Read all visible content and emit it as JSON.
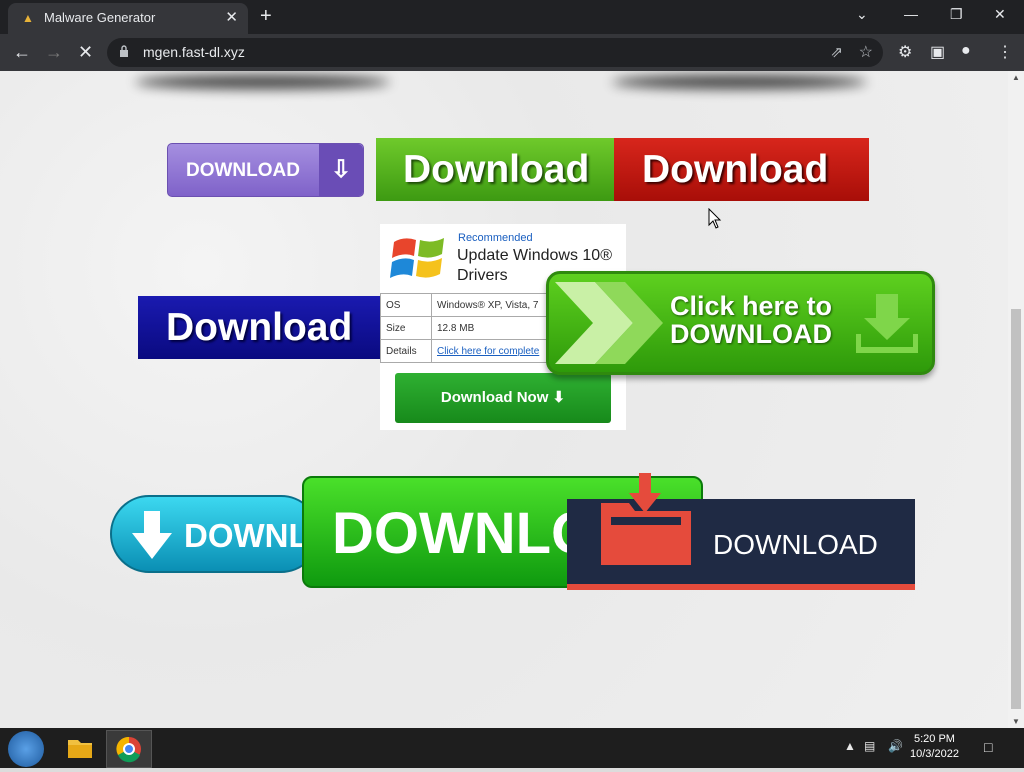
{
  "browser": {
    "tab_title": "Malware Generator",
    "url": "mgen.fast-dl.xyz"
  },
  "page": {
    "purple_button": "DOWNLOAD",
    "green_button": "Download",
    "red_button": "Download",
    "navy_button": "Download",
    "ad": {
      "recommended": "Recommended",
      "headline": "Update Windows 10® Drivers",
      "rows": [
        {
          "key": "OS",
          "value": "Windows® XP, Vista, 7"
        },
        {
          "key": "Size",
          "value": "12.8 MB"
        },
        {
          "key": "Details",
          "value": "Click here for complete"
        }
      ],
      "button": "Download Now"
    },
    "click_button": {
      "line1": "Click here to",
      "line2": "DOWNLOAD"
    },
    "cyan_button": "DOWNLOAD",
    "big_green_button": "DOWNLOAD",
    "dark_button": "DOWNLOAD"
  },
  "taskbar": {
    "time": "5:20 PM",
    "date": "10/3/2022"
  }
}
